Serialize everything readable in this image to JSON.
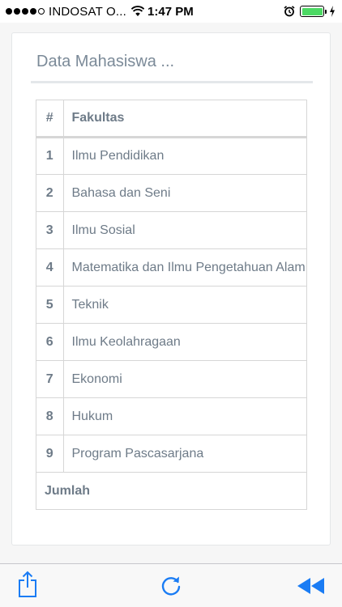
{
  "status_bar": {
    "carrier": "INDOSAT O...",
    "time": "1:47 PM",
    "battery_level": 1.0
  },
  "card": {
    "title": "Data Mahasiswa ..."
  },
  "table": {
    "headers": [
      "#",
      "Fakultas"
    ],
    "rows": [
      {
        "num": "1",
        "fakultas": "Ilmu Pendidikan"
      },
      {
        "num": "2",
        "fakultas": "Bahasa dan Seni"
      },
      {
        "num": "3",
        "fakultas": "Ilmu Sosial"
      },
      {
        "num": "4",
        "fakultas": "Matematika dan Ilmu Pengetahuan Alam"
      },
      {
        "num": "5",
        "fakultas": "Teknik"
      },
      {
        "num": "6",
        "fakultas": "Ilmu Keolahragaan"
      },
      {
        "num": "7",
        "fakultas": "Ekonomi"
      },
      {
        "num": "8",
        "fakultas": "Hukum"
      },
      {
        "num": "9",
        "fakultas": "Program Pascasarjana"
      }
    ],
    "footer_label": "Jumlah"
  },
  "toolbar": {
    "icons": [
      "share-icon",
      "reload-icon",
      "rewind-icon"
    ],
    "accent_color": "#1a7cf4"
  },
  "colors": {
    "text_muted": "#6e7b88",
    "battery": "#4cd964"
  }
}
